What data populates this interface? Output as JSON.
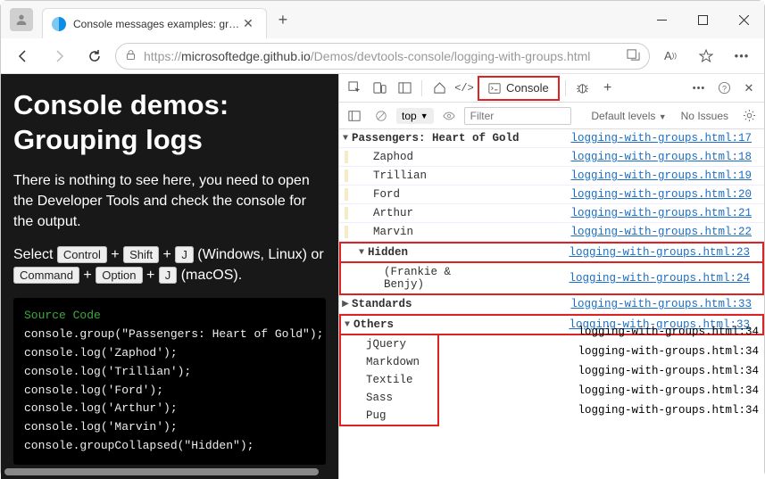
{
  "window": {
    "tab_title": "Console messages examples: gr…",
    "url_prefix": "https://",
    "url_host": "microsoftedge.github.io",
    "url_path": "/Demos/devtools-console/logging-with-groups.html"
  },
  "page": {
    "heading": "Console demos: Grouping logs",
    "body_p1": "There is nothing to see here, you need to open the Developer Tools and check the console for the output.",
    "body_p2a": "Select ",
    "kbd_ctrl": "Control",
    "kbd_shift": "Shift",
    "kbd_j": "J",
    "body_p2b": " (Windows, Linux) or ",
    "kbd_cmd": "Command",
    "kbd_opt": "Option",
    "body_p2c": " (macOS).",
    "code_title": "Source Code",
    "code_lines": [
      "console.group(\"Passengers: Heart of Gold\");",
      "console.log('Zaphod');",
      "console.log('Trillian');",
      "console.log('Ford');",
      "console.log('Arthur');",
      "console.log('Marvin');",
      "console.groupCollapsed(\"Hidden\");"
    ]
  },
  "devtools": {
    "tab_console": "Console",
    "context": "top",
    "filter_placeholder": "Filter",
    "levels": "Default levels",
    "issues": "No Issues",
    "groups": {
      "passengers": {
        "label": "Passengers: Heart of Gold",
        "src": "logging-with-groups.html:17"
      },
      "hidden": {
        "label": "Hidden",
        "src": "logging-with-groups.html:23"
      },
      "standards": {
        "label": "Standards",
        "src": "logging-with-groups.html:33"
      },
      "others": {
        "label": "Others",
        "src": "logging-with-groups.html:33"
      }
    },
    "rows": [
      {
        "msg": "Zaphod",
        "src": "logging-with-groups.html:18"
      },
      {
        "msg": "Trillian",
        "src": "logging-with-groups.html:19"
      },
      {
        "msg": "Ford",
        "src": "logging-with-groups.html:20"
      },
      {
        "msg": "Arthur",
        "src": "logging-with-groups.html:21"
      },
      {
        "msg": "Marvin",
        "src": "logging-with-groups.html:22"
      }
    ],
    "hidden_row": {
      "msg": "(Frankie & Benjy)",
      "src": "logging-with-groups.html:24"
    },
    "others_rows": [
      {
        "msg": "jQuery",
        "src": "logging-with-groups.html:34"
      },
      {
        "msg": "Markdown",
        "src": "logging-with-groups.html:34"
      },
      {
        "msg": "Textile",
        "src": "logging-with-groups.html:34"
      },
      {
        "msg": "Sass",
        "src": "logging-with-groups.html:34"
      },
      {
        "msg": "Pug",
        "src": "logging-with-groups.html:34"
      }
    ]
  }
}
